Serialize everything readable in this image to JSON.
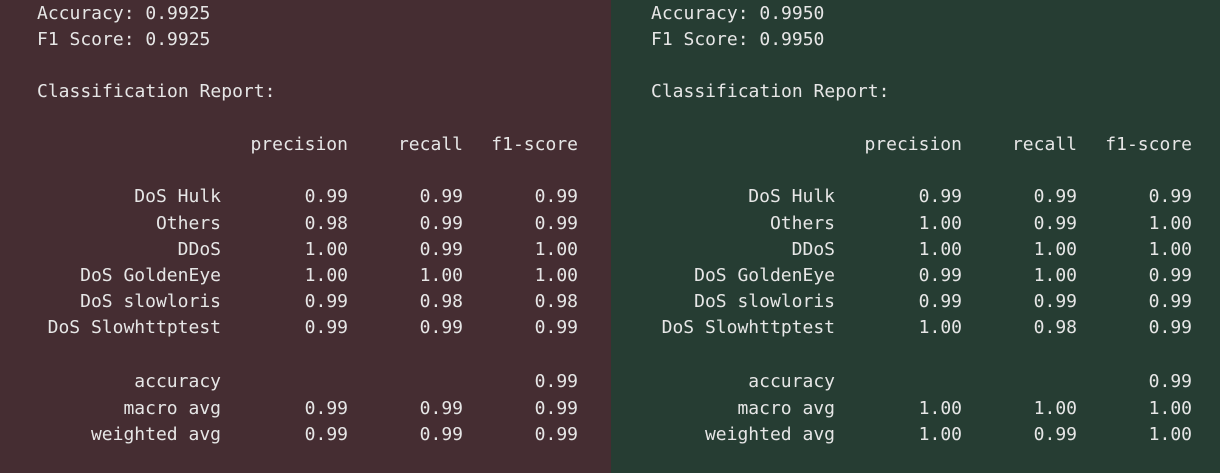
{
  "left": {
    "background": "#452d32",
    "accuracy_text": "Accuracy: 0.9925",
    "f1_text": "F1 Score: 0.9925",
    "report_title": "Classification Report:",
    "headers": {
      "precision": "precision",
      "recall": "recall",
      "f1": "f1-score"
    },
    "rows": [
      {
        "name": "DoS Hulk",
        "precision": "0.99",
        "recall": "0.99",
        "f1": "0.99"
      },
      {
        "name": "Others",
        "precision": "0.98",
        "recall": "0.99",
        "f1": "0.99"
      },
      {
        "name": "DDoS",
        "precision": "1.00",
        "recall": "0.99",
        "f1": "1.00"
      },
      {
        "name": "DoS GoldenEye",
        "precision": "1.00",
        "recall": "1.00",
        "f1": "1.00"
      },
      {
        "name": "DoS slowloris",
        "precision": "0.99",
        "recall": "0.98",
        "f1": "0.98"
      },
      {
        "name": "DoS Slowhttptest",
        "precision": "0.99",
        "recall": "0.99",
        "f1": "0.99"
      }
    ],
    "summary": [
      {
        "name": "accuracy",
        "precision": "",
        "recall": "",
        "f1": "0.99"
      },
      {
        "name": "macro avg",
        "precision": "0.99",
        "recall": "0.99",
        "f1": "0.99"
      },
      {
        "name": "weighted avg",
        "precision": "0.99",
        "recall": "0.99",
        "f1": "0.99"
      }
    ]
  },
  "right": {
    "background": "#263d33",
    "accuracy_text": "Accuracy: 0.9950",
    "f1_text": "F1 Score: 0.9950",
    "report_title": "Classification Report:",
    "headers": {
      "precision": "precision",
      "recall": "recall",
      "f1": "f1-score"
    },
    "rows": [
      {
        "name": "DoS Hulk",
        "precision": "0.99",
        "recall": "0.99",
        "f1": "0.99"
      },
      {
        "name": "Others",
        "precision": "1.00",
        "recall": "0.99",
        "f1": "1.00"
      },
      {
        "name": "DDoS",
        "precision": "1.00",
        "recall": "1.00",
        "f1": "1.00"
      },
      {
        "name": "DoS GoldenEye",
        "precision": "0.99",
        "recall": "1.00",
        "f1": "0.99"
      },
      {
        "name": "DoS slowloris",
        "precision": "0.99",
        "recall": "0.99",
        "f1": "0.99"
      },
      {
        "name": "DoS Slowhttptest",
        "precision": "1.00",
        "recall": "0.98",
        "f1": "0.99"
      }
    ],
    "summary": [
      {
        "name": "accuracy",
        "precision": "",
        "recall": "",
        "f1": "0.99"
      },
      {
        "name": "macro avg",
        "precision": "1.00",
        "recall": "1.00",
        "f1": "1.00"
      },
      {
        "name": "weighted avg",
        "precision": "1.00",
        "recall": "0.99",
        "f1": "1.00"
      }
    ]
  }
}
